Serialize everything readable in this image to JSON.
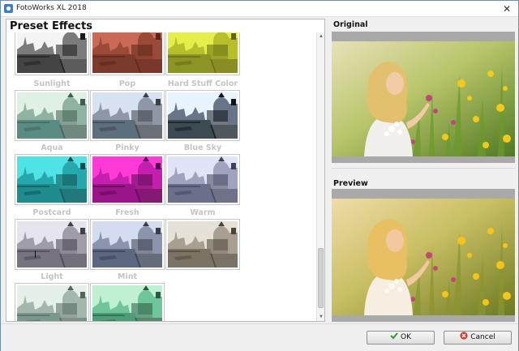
{
  "window": {
    "title": "FotoWorks XL 2018",
    "close_glyph": "✕"
  },
  "effects_panel": {
    "heading": "Preset Effects",
    "rows": [
      {
        "labels": [
          "",
          "",
          ""
        ],
        "tints": [
          "bw",
          "red",
          "yellow"
        ],
        "partial": true
      },
      {
        "labels": [
          "Sunlight",
          "Pop",
          "Hard Stuff Color"
        ],
        "tints": [
          "sunlight",
          "pop",
          "hardstuff"
        ]
      },
      {
        "labels": [
          "Aqua",
          "Pinky",
          "Blue Sky"
        ],
        "tints": [
          "aqua",
          "pinky",
          "bluesky"
        ]
      },
      {
        "labels": [
          "Postcard",
          "Fresh",
          "Warm"
        ],
        "tints": [
          "postcard",
          "fresh",
          "warm"
        ]
      },
      {
        "labels": [
          "Light",
          "Mint"
        ],
        "tints": [
          "light",
          "mint"
        ]
      }
    ],
    "scroll_position": 0.86
  },
  "original": {
    "title": "Original"
  },
  "preview": {
    "title": "Preview"
  },
  "buttons": {
    "ok": {
      "label": "OK",
      "icon": "check-icon"
    },
    "cancel": {
      "label": "Cancel",
      "icon": "cancel-icon"
    }
  },
  "colors": {
    "ok_check": "#2e9a2e",
    "cancel_red": "#d23a2a"
  }
}
